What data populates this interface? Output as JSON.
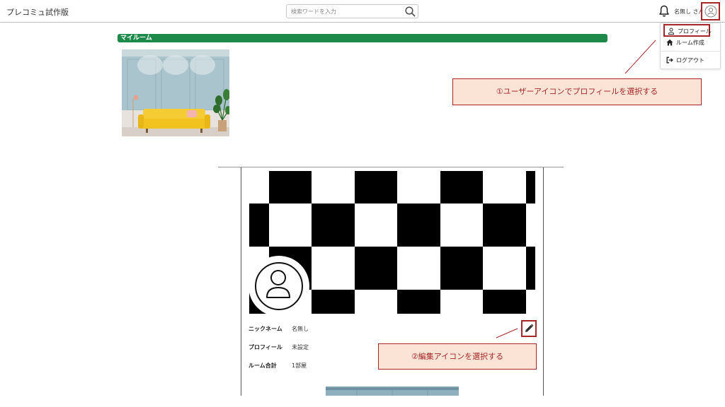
{
  "header": {
    "app_title": "プレコミュ試作版",
    "search_placeholder": "検索ワードを入力",
    "user_name": "名無し さん"
  },
  "dropdown": {
    "items": [
      {
        "label": "プロフィール",
        "icon": "user-icon"
      },
      {
        "label": "ルーム作成",
        "icon": "home-icon"
      },
      {
        "label": "ログアウト",
        "icon": "logout-icon"
      }
    ]
  },
  "annotations": {
    "step1": "①ユーザーアイコンでプロフィールを選択する",
    "step2": "②編集アイコンを選択する"
  },
  "my_room": {
    "title": "マイルーム"
  },
  "profile": {
    "rows": [
      {
        "label": "ニックネーム",
        "value": "名無し"
      },
      {
        "label": "プロフィール",
        "value": "未設定"
      },
      {
        "label": "ルーム合計",
        "value": "1部屋"
      }
    ]
  },
  "colors": {
    "accent_red": "#a8262a",
    "annotation_fill": "#fbe4d6",
    "room_bar_green": "#1d8a4a"
  }
}
